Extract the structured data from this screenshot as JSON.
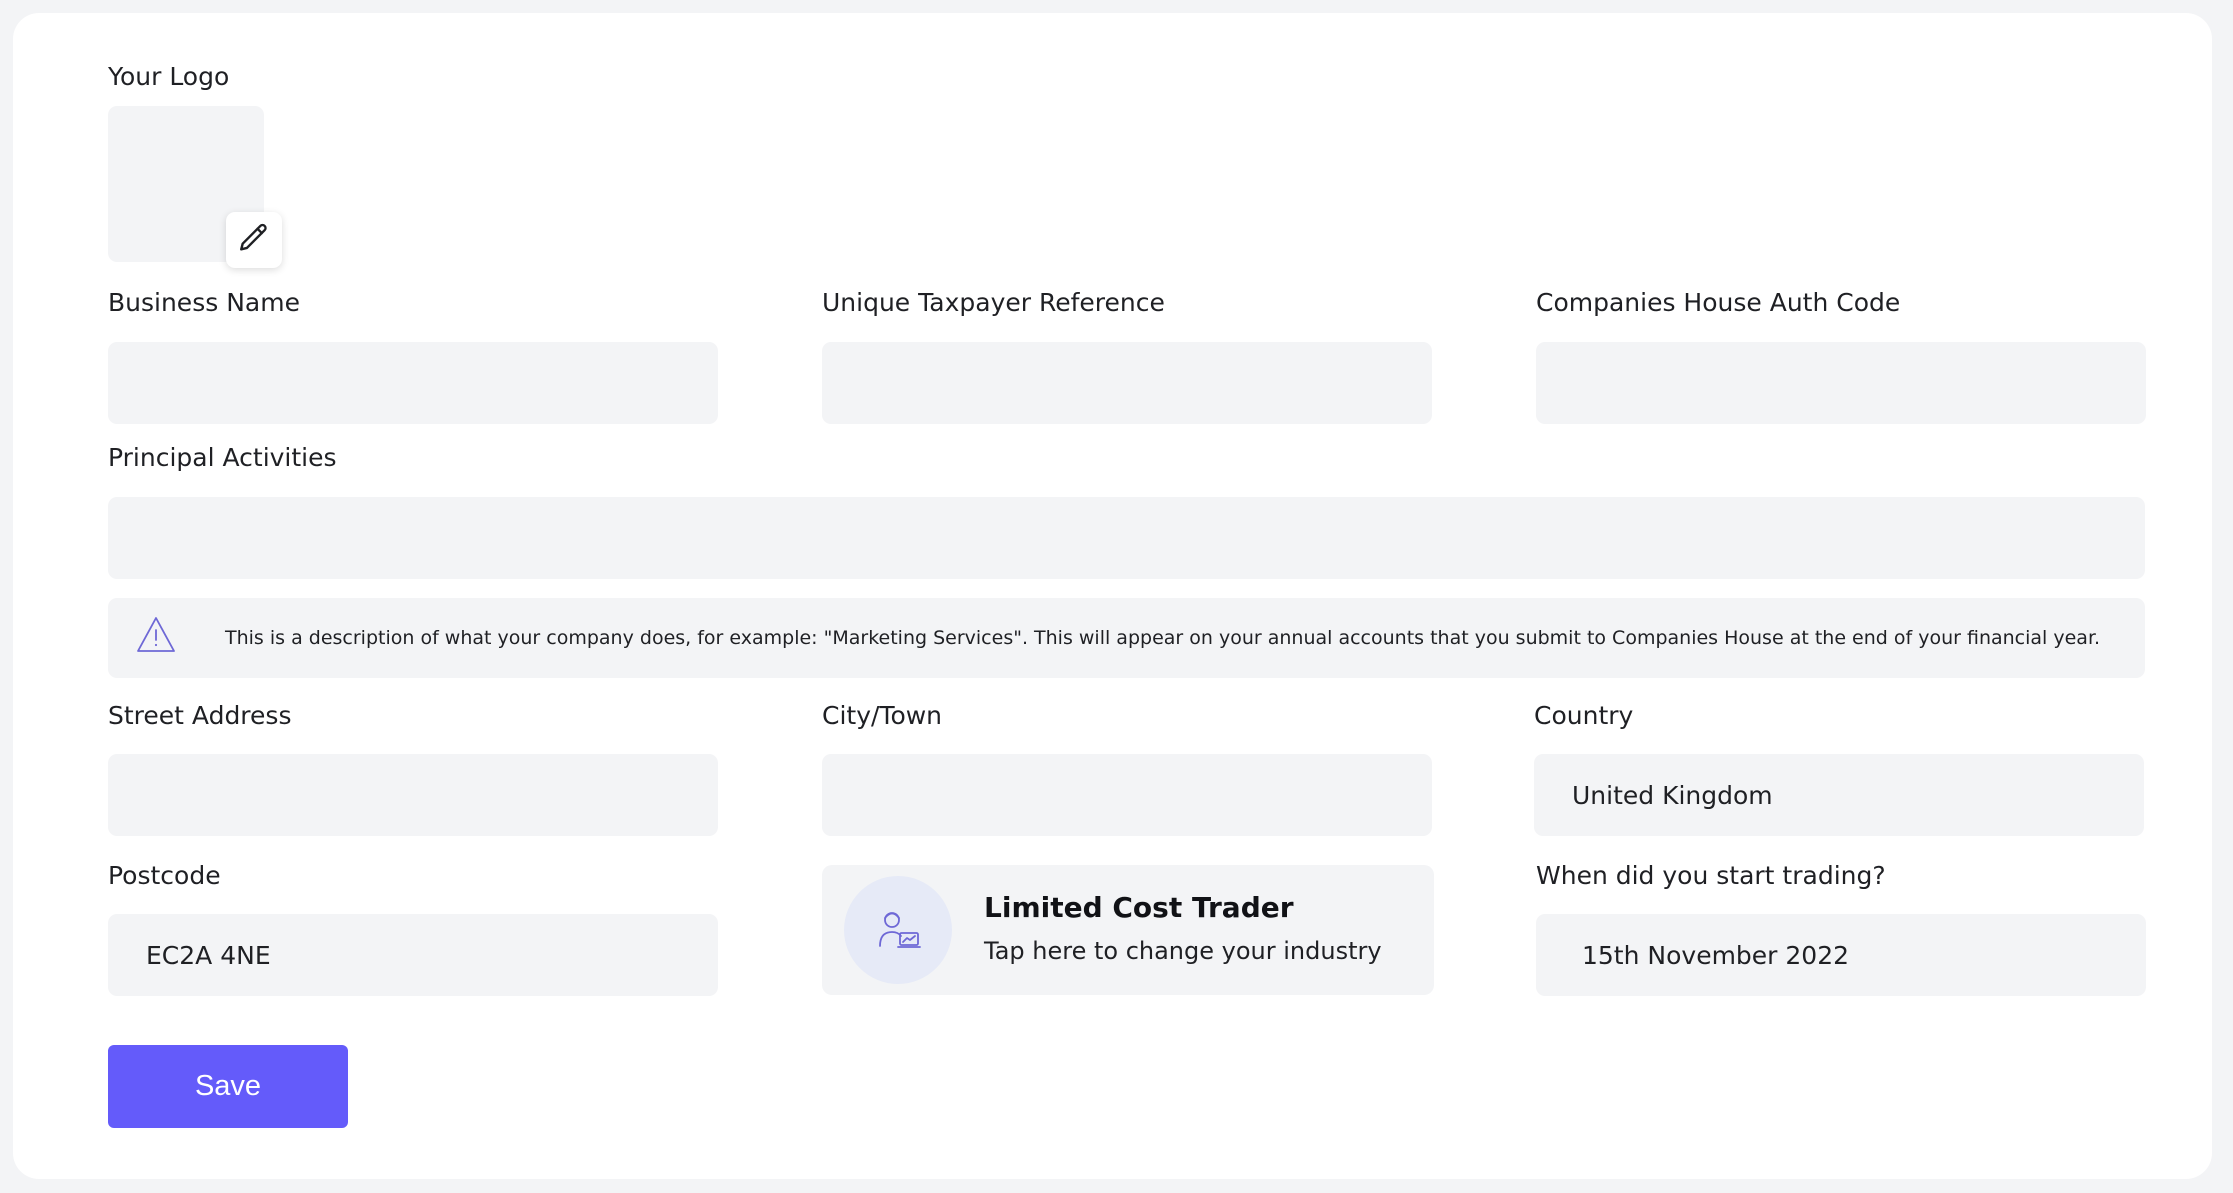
{
  "form": {
    "logo_label": "Your Logo",
    "business_name_label": "Business Name",
    "business_name_value": "",
    "utr_label": "Unique Taxpayer Reference",
    "utr_value": "",
    "auth_code_label": "Companies House Auth Code",
    "auth_code_value": "",
    "principal_activities_label": "Principal Activities",
    "principal_activities_value": "",
    "info_text": "This is a description of what your company does, for example: \"Marketing Services\". This will appear on your annual accounts that you submit to Companies House at the end of your financial year.",
    "street_label": "Street Address",
    "street_value": "",
    "city_label": "City/Town",
    "city_value": "",
    "country_label": "Country",
    "country_value": "United Kingdom",
    "postcode_label": "Postcode",
    "postcode_value": "EC2A 4NE",
    "industry_title": "Limited Cost Trader",
    "industry_subtitle": "Tap here to change your industry",
    "start_trading_label": "When did you start trading?",
    "start_trading_value": "15th November 2022",
    "save_label": "Save"
  },
  "icons": {
    "edit": "pencil-icon",
    "info": "warning-triangle-icon",
    "industry": "trader-person-icon"
  },
  "colors": {
    "accent": "#645bfa",
    "field_bg": "#f3f4f6",
    "icon_accent": "#6e68d6",
    "avatar_bg": "#e6eaf7"
  }
}
